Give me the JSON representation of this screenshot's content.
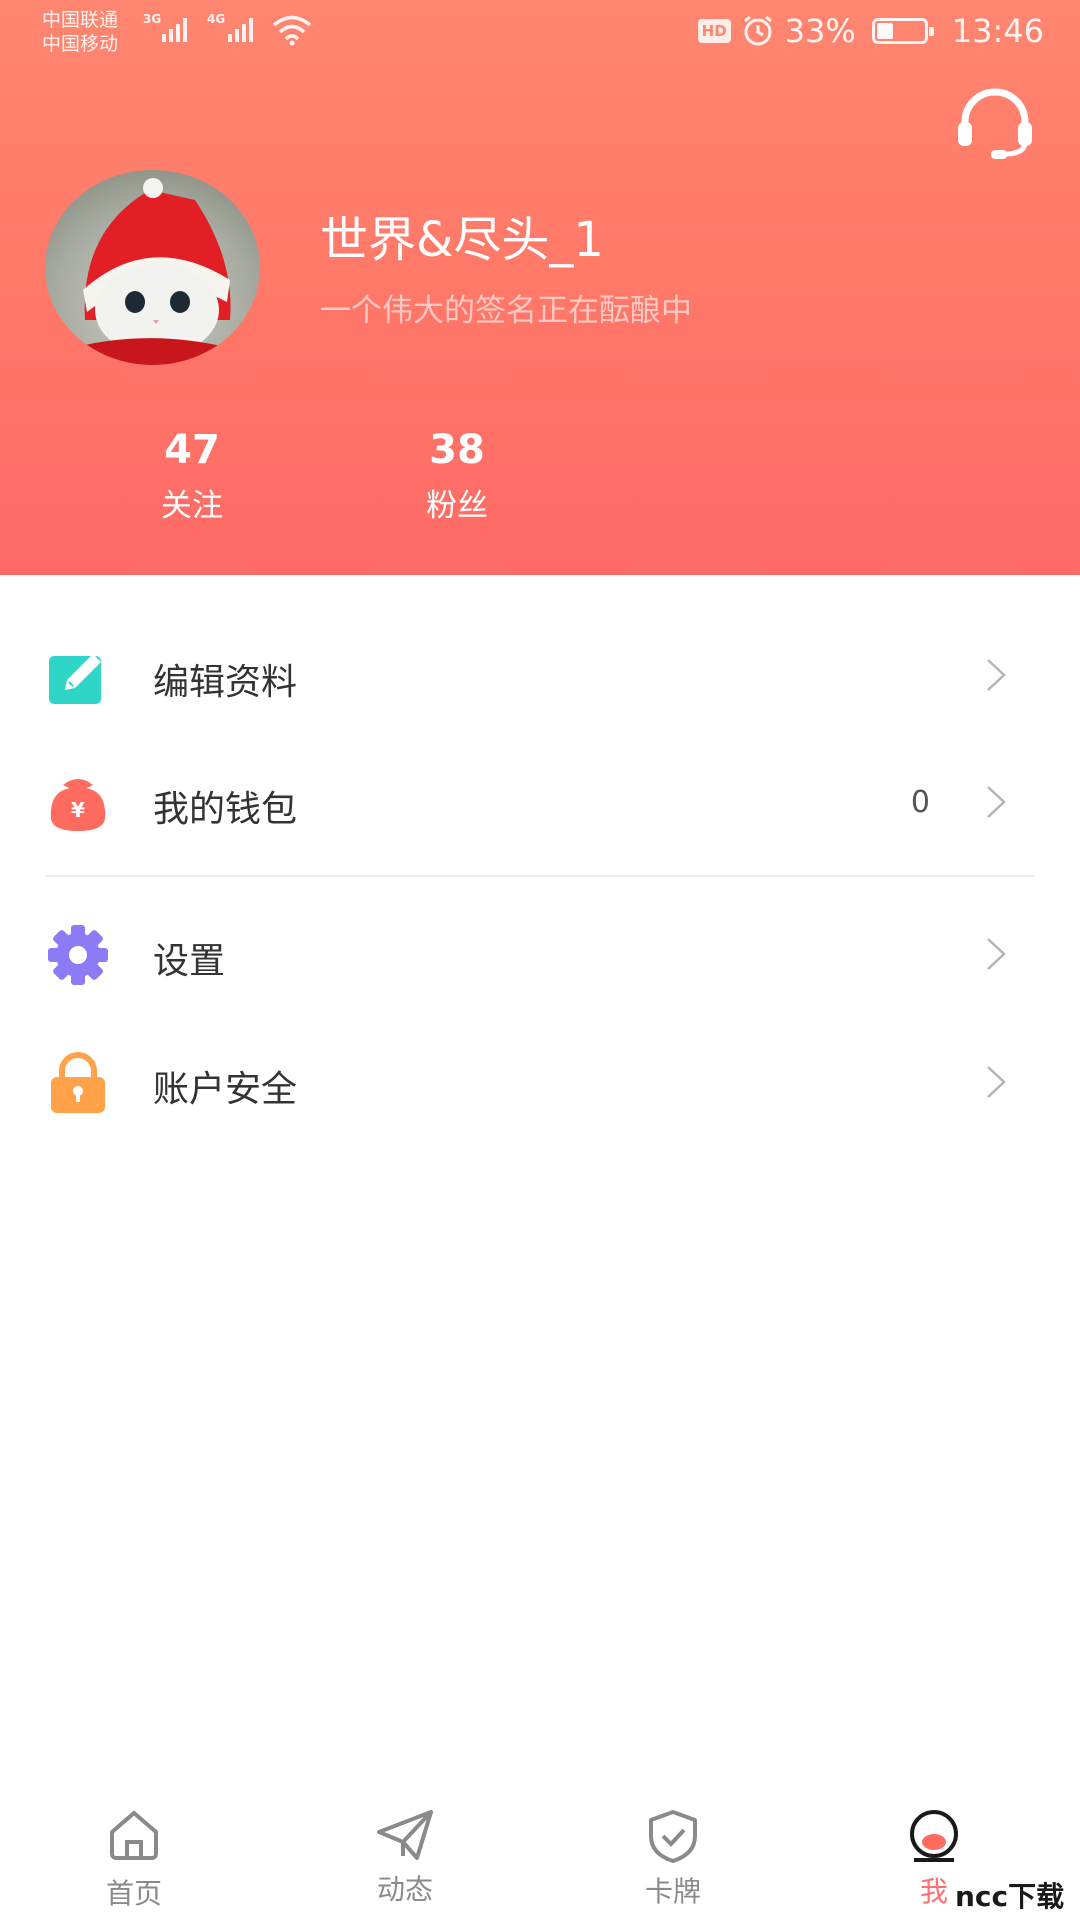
{
  "status_bar": {
    "carrier_1": "中国联通",
    "carrier_2": "中国移动",
    "network_1": "3G",
    "network_2": "4G",
    "hd_badge": "HD",
    "battery_percent": "33%",
    "battery_level": 0.33,
    "time": "13:46"
  },
  "profile": {
    "username": "世界&尽头_1",
    "signature": "一个伟大的签名正在酝酿中",
    "following_count": "47",
    "following_label": "关注",
    "followers_count": "38",
    "followers_label": "粉丝"
  },
  "menu": {
    "edit_profile": "编辑资料",
    "wallet": "我的钱包",
    "wallet_value": "0",
    "settings": "设置",
    "account_security": "账户安全"
  },
  "tabs": {
    "home": "首页",
    "feed": "动态",
    "cards": "卡牌",
    "me": "我"
  },
  "watermark": "ncc下载",
  "colors": {
    "header_gradient_top": "#ff8670",
    "header_gradient_bottom": "#ff6a66",
    "active_tab": "#ff7070",
    "edit_icon": "#2fd6c8",
    "wallet_icon": "#ff6b5e",
    "settings_icon": "#8b7cf6",
    "security_icon": "#ffa24a"
  }
}
